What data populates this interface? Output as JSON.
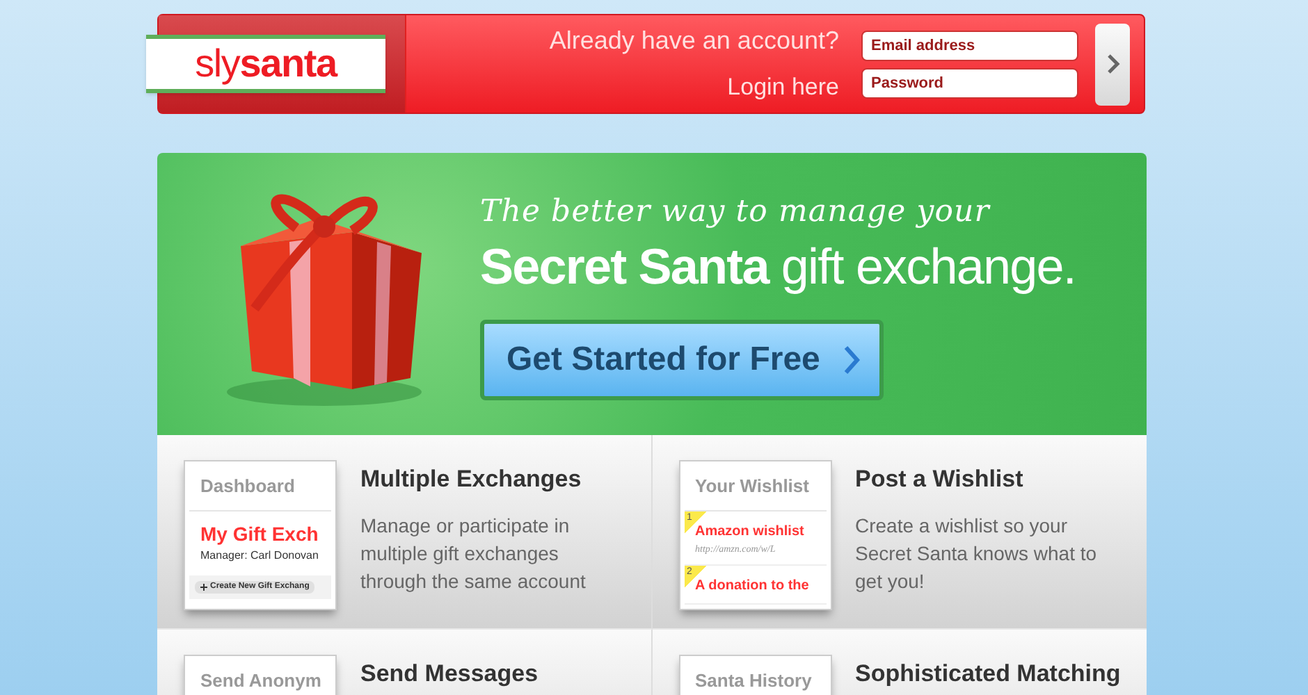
{
  "header": {
    "logo": "sly**santa**",
    "login_prompt": "Already have an account?",
    "login_label": "Login here",
    "email": {
      "placeholder": "Email address"
    },
    "password": {
      "placeholder": "Password"
    }
  },
  "hero": {
    "tagline": "The better way to manage your",
    "headline": "**Secret Santa** gift exchange.",
    "cta": "Get Started for Free"
  },
  "features": [
    {
      "title": "Multiple Exchanges",
      "description": "Manage or participate in multiple gift exchanges through the same account",
      "thumbnail": {
        "heading": "Dashboard",
        "items": [
          {
            "kind": "red-title",
            "text": "My Gift Exch"
          },
          {
            "kind": "caption",
            "text": "Manager: Carl Donovan"
          },
          {
            "kind": "button",
            "text": "Create New Gift Exchang"
          }
        ]
      }
    },
    {
      "title": "Post a Wishlist",
      "description": "Create a wishlist so your Secret Santa knows what to get you!",
      "thumbnail": {
        "heading": "Your Wishlist",
        "items": [
          {
            "kind": "numbered",
            "number": "1",
            "text": "Amazon wishlist",
            "url": "http://amzn.com/w/L"
          },
          {
            "kind": "numbered",
            "number": "2",
            "text": "A donation to the"
          }
        ]
      }
    },
    {
      "title": "Send Messages",
      "thumbnail": {
        "heading": "Send Anonym"
      }
    },
    {
      "title": "Sophisticated Matching",
      "thumbnail": {
        "heading": "Santa History"
      }
    }
  ]
}
